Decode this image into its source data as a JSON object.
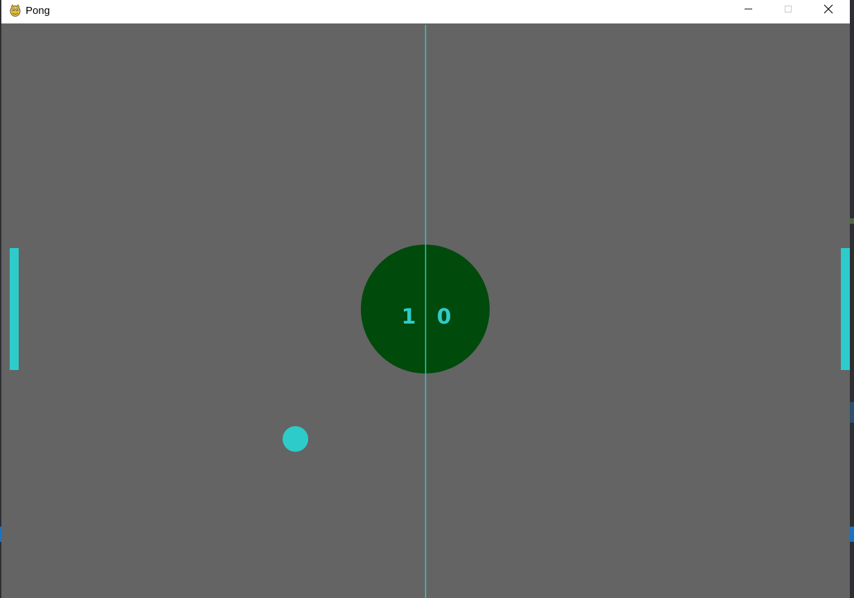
{
  "window": {
    "title": "Pong",
    "icon": "pygame-snake-icon",
    "controls": {
      "minimize_icon": "minimize-icon",
      "maximize_icon": "maximize-icon",
      "close_icon": "close-icon"
    }
  },
  "game": {
    "score_left": "1",
    "score_right": "0",
    "colors": {
      "background": "#646464",
      "accent": "#2ecbcb",
      "score_circle": "#004a0c"
    }
  }
}
